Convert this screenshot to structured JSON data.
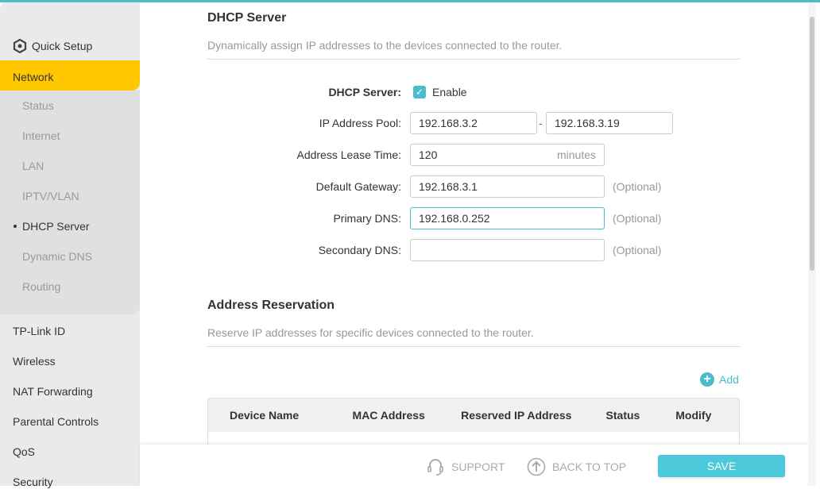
{
  "sidebar": {
    "quick_setup": "Quick Setup",
    "network": "Network",
    "sub_items": [
      "Status",
      "Internet",
      "LAN",
      "IPTV/VLAN",
      "DHCP Server",
      "Dynamic DNS",
      "Routing"
    ],
    "main_items": [
      "TP-Link ID",
      "Wireless",
      "NAT Forwarding",
      "Parental Controls",
      "QoS",
      "Security"
    ]
  },
  "dhcp": {
    "title": "DHCP Server",
    "description": "Dynamically assign IP addresses to the devices connected to the router.",
    "server_label": "DHCP Server:",
    "enable_label": "Enable",
    "enabled": true,
    "pool_label": "IP Address Pool:",
    "pool_start": "192.168.3.2",
    "pool_end": "192.168.3.19",
    "lease_label": "Address Lease Time:",
    "lease": "120",
    "lease_unit": "minutes",
    "gateway_label": "Default Gateway:",
    "gateway": "192.168.3.1",
    "primary_dns_label": "Primary DNS:",
    "primary_dns": "192.168.0.252",
    "secondary_dns_label": "Secondary DNS:",
    "secondary_dns": "",
    "optional": "(Optional)"
  },
  "reservation": {
    "title": "Address Reservation",
    "description": "Reserve IP addresses for specific devices connected to the router.",
    "add": "Add",
    "columns": [
      "Device Name",
      "MAC Address",
      "Reserved IP Address",
      "Status",
      "Modify"
    ]
  },
  "footer": {
    "support": "SUPPORT",
    "back_to_top": "BACK TO TOP",
    "save": "SAVE"
  }
}
